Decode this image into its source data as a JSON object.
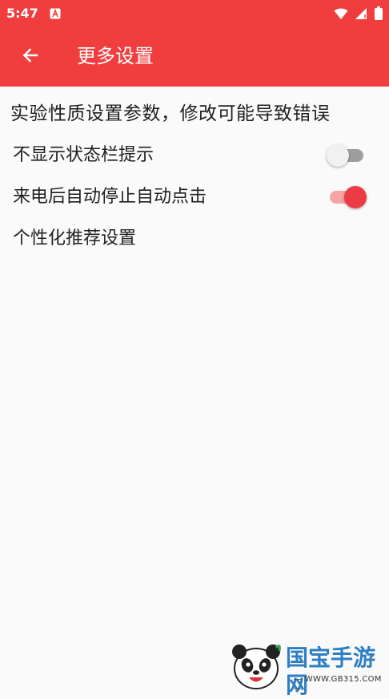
{
  "status_bar": {
    "time": "5:47"
  },
  "app_bar": {
    "title": "更多设置"
  },
  "main": {
    "warning_text": "实验性质设置参数，修改可能导致错误",
    "settings": [
      {
        "label": "不显示状态栏提示",
        "enabled": false
      },
      {
        "label": "来电后自动停止自动点击",
        "enabled": true
      },
      {
        "label": "个性化推荐设置"
      }
    ]
  },
  "watermark": {
    "brand": "国宝手游网",
    "url": "— WWW.GB315.COM —"
  },
  "colors": {
    "accent": "#f03e3e",
    "switch_on_thumb": "#ec3b45",
    "switch_on_track": "#f7a4a4",
    "switch_off_thumb": "#f1f1f1",
    "switch_off_track": "#9e9e9e",
    "background": "#fafafa"
  },
  "icons": {
    "back": "arrow-left-icon",
    "status_left": "a-notification-icon",
    "wifi": "wifi-icon",
    "signal": "signal-icon",
    "battery": "battery-icon"
  }
}
